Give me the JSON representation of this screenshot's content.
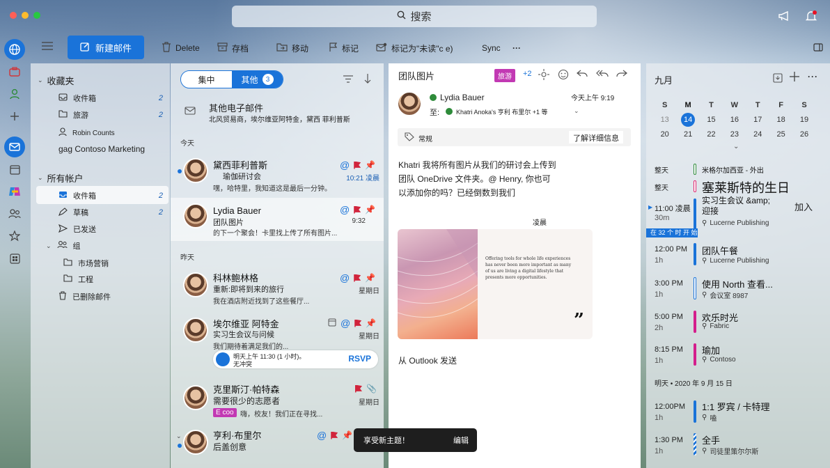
{
  "search": {
    "label": "搜索"
  },
  "toolbar": {
    "new_mail": "新建邮件",
    "delete": "Delete",
    "archive": "存档",
    "move": "移动",
    "flag": "标记",
    "mark_unread": "标记为\"未读\"c e)",
    "sync": "Sync",
    "more": "···"
  },
  "folders": {
    "favorites": "收藏夹",
    "fav_items": [
      {
        "label": "收件箱",
        "count": "2"
      },
      {
        "label": "旅游",
        "count": "2"
      },
      {
        "label": "Robin Counts",
        "count": ""
      },
      {
        "label": "gag Contoso Marketing",
        "count": ""
      }
    ],
    "all_accounts": "所有帐户",
    "acct_items": [
      {
        "label": "收件箱",
        "count": "2"
      },
      {
        "label": "草稿",
        "count": "2"
      },
      {
        "label": "已发送",
        "count": ""
      },
      {
        "label": "组",
        "count": ""
      },
      {
        "label": "市场营销",
        "count": ""
      },
      {
        "label": "工程",
        "count": ""
      },
      {
        "label": "已删除邮件",
        "count": ""
      }
    ]
  },
  "list": {
    "focused": "集中",
    "other": "其他",
    "other_count": "3",
    "other_mail_title": "其他电子邮件",
    "other_mail_sub": "北风贸易商，埃尔维亚阿特金，黛西 菲利普斯",
    "today": "今天",
    "yesterday": "昨天",
    "messages": [
      {
        "sender": "黛西菲利普斯",
        "subject": "瑜伽研讨会",
        "preview": "嘿，哈特里，我知道这是最后一分钟。",
        "time": "10:21 凌晨"
      },
      {
        "sender": "Lydia Bauer",
        "subject": "团队图片",
        "preview": "的下一个聚会！卡里找上传了所有图片...",
        "time": "9:32"
      },
      {
        "sender": "科林鲍林格",
        "subject": "重新:即将到来的旅行",
        "preview": "我在酒店附近找到了这些餐厅...",
        "time": "星期日"
      },
      {
        "sender": "埃尔维亚 阿特金",
        "subject": "实习生会议与问候",
        "preview": "我们期待着满足我们的...",
        "time": "星期日"
      },
      {
        "sender": "克里斯汀·帕特森",
        "subject": "需要很少的志愿者",
        "preview": "嗨，校友！我们正在寻找...",
        "time": "星期日"
      },
      {
        "sender": "亨利·布里尔",
        "subject": "后盖创意",
        "preview": "",
        "time": ""
      }
    ],
    "rsvp_text": "明天上午 11:30 (1 小时)。",
    "rsvp_sub": "无冲突",
    "rsvp_btn": "RSVP",
    "tag_eco": "E coo"
  },
  "reading": {
    "title": "团队图片",
    "tag": "旅游",
    "plus": "+2",
    "sender": "Lydia Bauer",
    "time": "今天上午 9:19",
    "to_label": "至:",
    "recipients": "Khatri Anoka's  亨利 布里尔  +1 等",
    "category": "常规",
    "learn_more": "了解详细信息",
    "body": "Khatri 我将所有图片从我们的研讨会上传到团队 OneDrive 文件夹。@ Henry, 你也可以添加你的吗？已经倒数到我们",
    "time_label": "凌晨",
    "image_text": "Offering tools for whole life experiences has never been more important as many of us are living a digital lifestyle that presents more opportunities.",
    "signature": "从 Outlook 发送"
  },
  "calendar": {
    "month": "九月",
    "weekdays": [
      "S",
      "M",
      "T",
      "W",
      "T",
      "F",
      "S"
    ],
    "weeks": [
      [
        "13",
        "14",
        "15",
        "16",
        "17",
        "18",
        "19"
      ],
      [
        "20",
        "21",
        "22",
        "23",
        "24",
        "25",
        "26"
      ]
    ],
    "today": "14",
    "add_label": "加入",
    "now_label": "在 32 个 时 开 始",
    "tomorrow_header": "明天 • 2020 年 9 月 15 日",
    "events": [
      {
        "time": "整天",
        "dur": "",
        "title": "米格尔加西亚 - 外出",
        "loc": "",
        "color": "#2e8b3a"
      },
      {
        "time": "整天",
        "dur": "",
        "title": "塞莱斯特的生日",
        "loc": "",
        "color": "#e0256f"
      },
      {
        "time": "11:00 凌晨",
        "dur": "30m",
        "title": "实习生会议 &amp; 迎接",
        "loc": "Lucerne Publishing",
        "color": "#1a73d9"
      },
      {
        "time": "12:00 PM",
        "dur": "1h",
        "title": "团队午餐",
        "loc": "Lucerne Publishing",
        "color": "#1a73d9"
      },
      {
        "time": "3:00 PM",
        "dur": "1h",
        "title": "使用 North 查看...",
        "loc": "会议室 8987",
        "color": "#1a73d9"
      },
      {
        "time": "5:00 PM",
        "dur": "2h",
        "title": "欢乐时光",
        "loc": "Fabric",
        "color": "#d41e8c"
      },
      {
        "time": "8:15 PM",
        "dur": "1h",
        "title": "瑜加",
        "loc": "Contoso",
        "color": "#d41e8c"
      },
      {
        "time": "12:00PM",
        "dur": "1h",
        "title": "1:1 罗宾 / 卡特理",
        "loc": "嗑",
        "color": "#1a73d9"
      },
      {
        "time": "1:30 PM",
        "dur": "1h",
        "title": "全手",
        "loc": "司徒里策尔尔斯",
        "color": "#1a73d9"
      }
    ]
  },
  "toast": {
    "text": "享受新主题！",
    "action": "编辑"
  }
}
